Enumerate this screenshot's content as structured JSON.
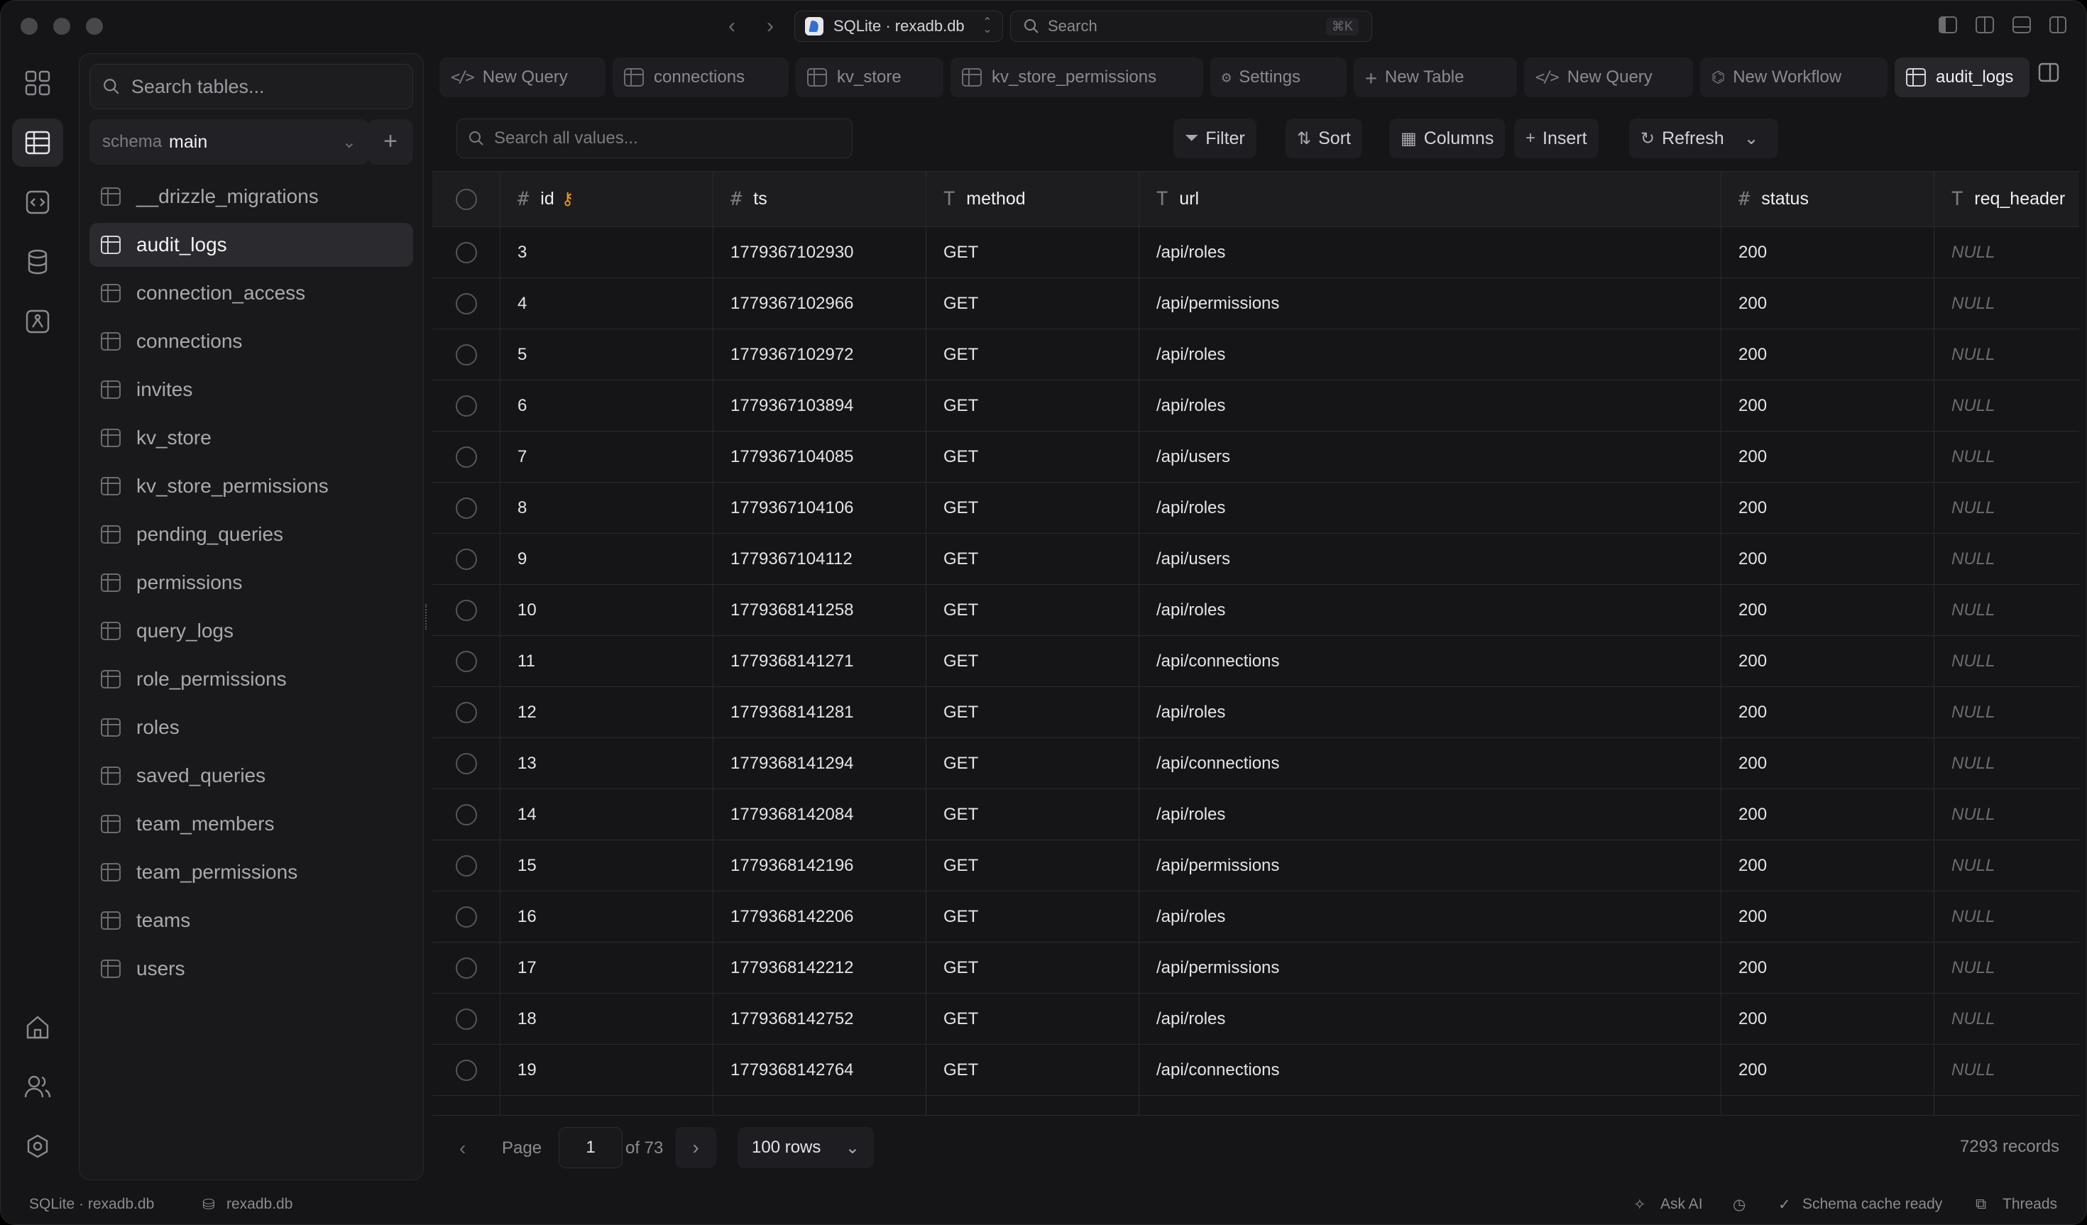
{
  "titlebar": {
    "connection_label": "SQLite · rexadb.db",
    "search_placeholder": "Search",
    "search_shortcut": "⌘K"
  },
  "sidebar": {
    "search_placeholder": "Search tables...",
    "schema_key": "schema",
    "schema_value": "main",
    "tables": [
      {
        "label": "__drizzle_migrations"
      },
      {
        "label": "audit_logs"
      },
      {
        "label": "connection_access"
      },
      {
        "label": "connections"
      },
      {
        "label": "invites"
      },
      {
        "label": "kv_store"
      },
      {
        "label": "kv_store_permissions"
      },
      {
        "label": "pending_queries"
      },
      {
        "label": "permissions"
      },
      {
        "label": "query_logs"
      },
      {
        "label": "role_permissions"
      },
      {
        "label": "roles"
      },
      {
        "label": "saved_queries"
      },
      {
        "label": "team_members"
      },
      {
        "label": "team_permissions"
      },
      {
        "label": "teams"
      },
      {
        "label": "users"
      }
    ],
    "active_table": "audit_logs"
  },
  "tabs": [
    {
      "label": "New Query",
      "icon": "code-icon"
    },
    {
      "label": "connections",
      "icon": "table-icon"
    },
    {
      "label": "kv_store",
      "icon": "table-icon"
    },
    {
      "label": "kv_store_permissions",
      "icon": "table-icon"
    },
    {
      "label": "Settings",
      "icon": "gear-icon"
    },
    {
      "label": "New Table",
      "icon": "plus-icon"
    },
    {
      "label": "New Query",
      "icon": "code-icon"
    },
    {
      "label": "New Workflow",
      "icon": "workflow-icon"
    },
    {
      "label": "audit_logs",
      "icon": "table-icon"
    }
  ],
  "toolbar": {
    "search_placeholder": "Search all values...",
    "filter": "Filter",
    "sort": "Sort",
    "columns": "Columns",
    "insert": "Insert",
    "refresh": "Refresh"
  },
  "table": {
    "columns": [
      {
        "name": "id",
        "type_icon": "#",
        "primary_key": true
      },
      {
        "name": "ts",
        "type_icon": "#"
      },
      {
        "name": "method",
        "type_icon": "T"
      },
      {
        "name": "url",
        "type_icon": "T"
      },
      {
        "name": "status",
        "type_icon": "#"
      },
      {
        "name": "req_header",
        "type_icon": "T"
      }
    ],
    "rows": [
      [
        "3",
        "1779367102930",
        "GET",
        "/api/roles",
        "200",
        "NULL"
      ],
      [
        "4",
        "1779367102966",
        "GET",
        "/api/permissions",
        "200",
        "NULL"
      ],
      [
        "5",
        "1779367102972",
        "GET",
        "/api/roles",
        "200",
        "NULL"
      ],
      [
        "6",
        "1779367103894",
        "GET",
        "/api/roles",
        "200",
        "NULL"
      ],
      [
        "7",
        "1779367104085",
        "GET",
        "/api/users",
        "200",
        "NULL"
      ],
      [
        "8",
        "1779367104106",
        "GET",
        "/api/roles",
        "200",
        "NULL"
      ],
      [
        "9",
        "1779367104112",
        "GET",
        "/api/users",
        "200",
        "NULL"
      ],
      [
        "10",
        "1779368141258",
        "GET",
        "/api/roles",
        "200",
        "NULL"
      ],
      [
        "11",
        "1779368141271",
        "GET",
        "/api/connections",
        "200",
        "NULL"
      ],
      [
        "12",
        "1779368141281",
        "GET",
        "/api/roles",
        "200",
        "NULL"
      ],
      [
        "13",
        "1779368141294",
        "GET",
        "/api/connections",
        "200",
        "NULL"
      ],
      [
        "14",
        "1779368142084",
        "GET",
        "/api/roles",
        "200",
        "NULL"
      ],
      [
        "15",
        "1779368142196",
        "GET",
        "/api/permissions",
        "200",
        "NULL"
      ],
      [
        "16",
        "1779368142206",
        "GET",
        "/api/roles",
        "200",
        "NULL"
      ],
      [
        "17",
        "1779368142212",
        "GET",
        "/api/permissions",
        "200",
        "NULL"
      ],
      [
        "18",
        "1779368142752",
        "GET",
        "/api/roles",
        "200",
        "NULL"
      ],
      [
        "19",
        "1779368142764",
        "GET",
        "/api/connections",
        "200",
        "NULL"
      ]
    ]
  },
  "pagination": {
    "page_label": "Page",
    "page_value": "1",
    "of_label": "of 73",
    "rows_per_page": "100 rows",
    "records": "7293 records"
  },
  "statusbar": {
    "connection": "SQLite · rexadb.db",
    "database": "rexadb.db",
    "ask_ai": "Ask AI",
    "schema_cache": "Schema cache ready",
    "threads": "Threads"
  }
}
